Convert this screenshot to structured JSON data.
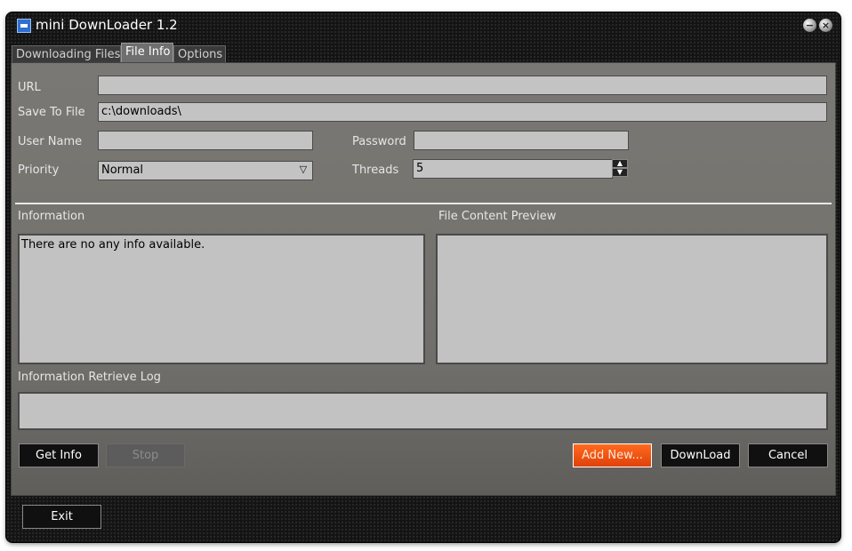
{
  "window": {
    "title": "mini DownLoader 1.2",
    "minimize_icon": "minimize-icon",
    "close_icon": "close-icon"
  },
  "tabs": [
    {
      "label": "Downloading Files",
      "active": false
    },
    {
      "label": "File Info",
      "active": true
    },
    {
      "label": "Options",
      "active": false
    }
  ],
  "form": {
    "url_label": "URL",
    "url_value": "",
    "save_label": "Save To File",
    "save_value": "c:\\downloads\\",
    "username_label": "User Name",
    "username_value": "",
    "password_label": "Password",
    "password_value": "",
    "priority_label": "Priority",
    "priority_value": "Normal",
    "threads_label": "Threads",
    "threads_value": "5"
  },
  "info": {
    "information_label": "Information",
    "information_text": "There are no any info available.",
    "preview_label": "File Content Preview",
    "preview_text": "",
    "log_label": "Information Retrieve Log",
    "log_text": ""
  },
  "buttons": {
    "get_info": "Get Info",
    "stop": "Stop",
    "add_new": "Add New...",
    "download": "DownLoad",
    "cancel": "Cancel",
    "exit": "Exit"
  },
  "colors": {
    "accent": "#ff5a14",
    "panel": "#747270",
    "field": "#c3c3c3",
    "frame": "#141414"
  }
}
